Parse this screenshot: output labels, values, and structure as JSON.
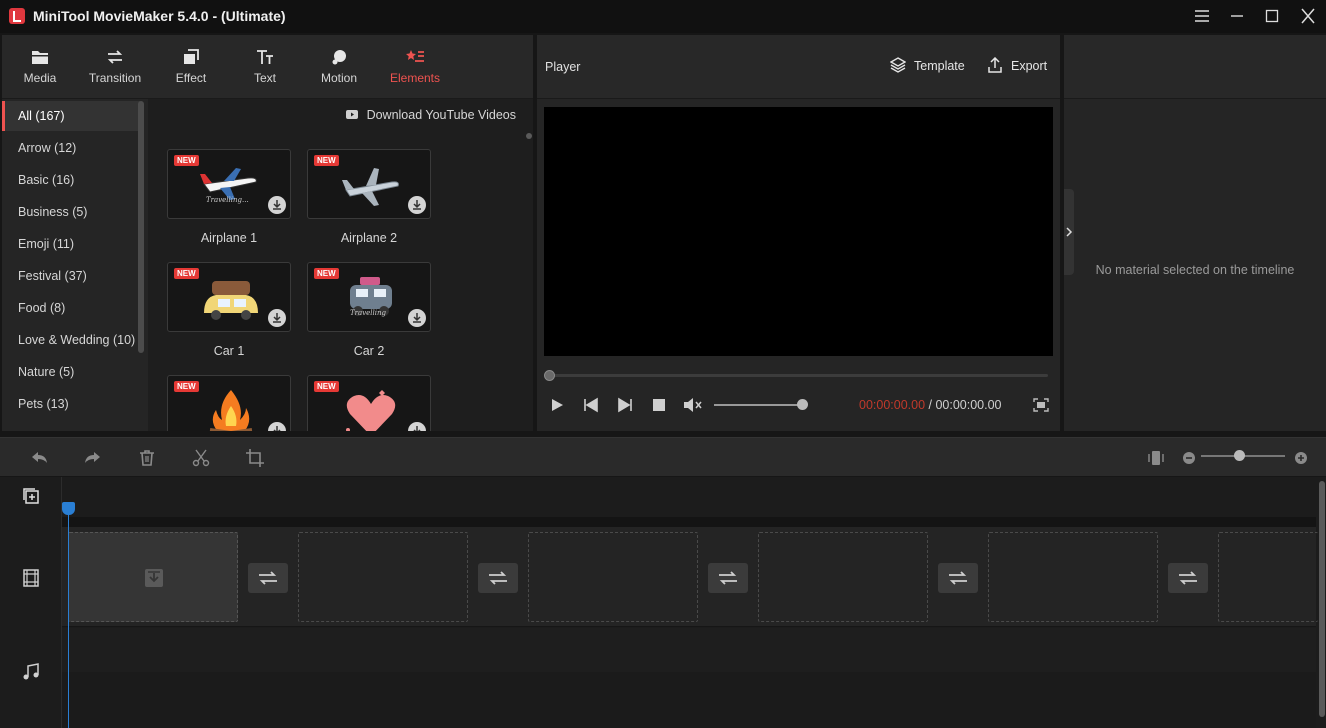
{
  "window": {
    "title": "MiniTool MovieMaker 5.4.0 - (Ultimate)"
  },
  "toolbar": {
    "tools": [
      {
        "label": "Media",
        "icon": "folder-icon"
      },
      {
        "label": "Transition",
        "icon": "transition-icon"
      },
      {
        "label": "Effect",
        "icon": "effect-icon"
      },
      {
        "label": "Text",
        "icon": "text-icon"
      },
      {
        "label": "Motion",
        "icon": "motion-icon"
      },
      {
        "label": "Elements",
        "icon": "elements-icon",
        "active": true
      }
    ]
  },
  "categories": {
    "items": [
      {
        "label": "All (167)",
        "active": true
      },
      {
        "label": "Arrow (12)"
      },
      {
        "label": "Basic (16)"
      },
      {
        "label": "Business (5)"
      },
      {
        "label": "Emoji (11)"
      },
      {
        "label": "Festival (37)"
      },
      {
        "label": "Food (8)"
      },
      {
        "label": "Love & Wedding (10)"
      },
      {
        "label": "Nature (5)"
      },
      {
        "label": "Pets (13)"
      }
    ]
  },
  "gallery": {
    "download_link": "Download YouTube Videos",
    "badge": "NEW",
    "items": [
      {
        "label": "Airplane 1",
        "caption": "Travelling..."
      },
      {
        "label": "Airplane 2"
      },
      {
        "label": "Car 1"
      },
      {
        "label": "Car 2",
        "caption": "Travelling"
      },
      {
        "label": ""
      },
      {
        "label": ""
      }
    ]
  },
  "player": {
    "title": "Player",
    "template_label": "Template",
    "export_label": "Export",
    "current_time": "00:00:00.00",
    "separator": " / ",
    "total_time": "00:00:00.00",
    "progress": 0,
    "volume": 0.95
  },
  "properties": {
    "empty_text": "No material selected on the timeline"
  },
  "timeline": {
    "zoom_level": 0.45,
    "slots": 6
  },
  "colors": {
    "accent": "#ef5350",
    "playhead": "#2a7fd4",
    "timecode_current": "#c0392b"
  }
}
